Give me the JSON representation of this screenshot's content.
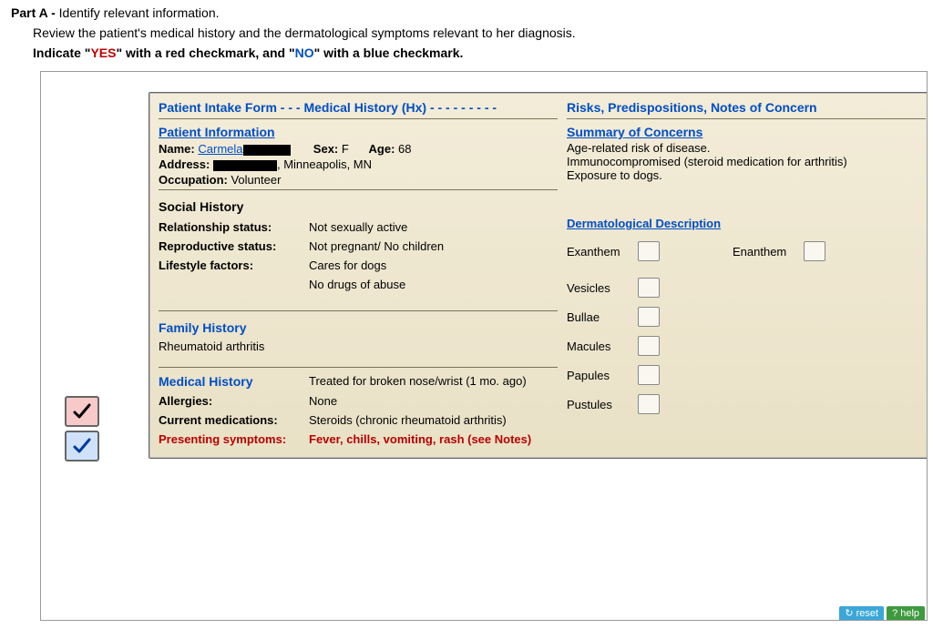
{
  "header": {
    "part_label": "Part A -",
    "part_title": "Identify relevant information.",
    "instruction1": "Review the patient's medical history and the dermatological symptoms relevant to her diagnosis.",
    "instruction2_prefix": "Indicate \"",
    "yes": "YES",
    "instruction2_mid": "\" with a red checkmark, and \"",
    "no": "NO",
    "instruction2_suffix": "\" with a blue checkmark."
  },
  "form": {
    "top_left_title_1": "Patient Intake Form",
    "top_left_dash": " - - - ",
    "top_left_title_2": "Medical History (Hx)",
    "top_left_trail": " - - - - - - - - -",
    "top_right_title": "Risks, Predispositions, Notes of Concern",
    "patient_info": {
      "heading": "Patient Information",
      "name_label": "Name:",
      "name_value": "Carmela",
      "sex_label": "Sex:",
      "sex_value": "F",
      "age_label": "Age:",
      "age_value": "68",
      "address_label": "Address:",
      "address_value": ", Minneapolis, MN",
      "occupation_label": "Occupation:",
      "occupation_value": "Volunteer"
    },
    "social": {
      "heading": "Social History",
      "rel_label": "Relationship status:",
      "rel_value": "Not sexually active",
      "rep_label": "Reproductive status:",
      "rep_value": "Not pregnant/ No children",
      "life_label": "Lifestyle factors:",
      "life_value1": "Cares for dogs",
      "life_value2": "No drugs of abuse"
    },
    "family": {
      "heading": "Family History",
      "value": "Rheumatoid arthritis"
    },
    "medical": {
      "heading": "Medical History",
      "heading_value": "Treated for broken nose/wrist (1 mo. ago)",
      "allergies_label": "Allergies:",
      "allergies_value": "None",
      "meds_label": "Current medications:",
      "meds_value": "Steroids (chronic rheumatoid arthritis)",
      "presenting_label": "Presenting symptoms:",
      "presenting_value": "Fever, chills, vomiting, rash (see Notes)"
    },
    "concerns": {
      "heading": "Summary of Concerns",
      "l1": "Age-related risk of disease.",
      "l2": "Immunocompromised (steroid medication for arthritis)",
      "l3": "Exposure to dogs."
    },
    "derm": {
      "heading": "Dermatological Description",
      "exanthem": "Exanthem",
      "enanthem": "Enanthem",
      "vesicles": "Vesicles",
      "bullae": "Bullae",
      "macules": "Macules",
      "papules": "Papules",
      "pustules": "Pustules"
    }
  },
  "buttons": {
    "reset": "reset",
    "help": "help"
  },
  "palette": {
    "yes_icon": "check-icon",
    "no_icon": "check-icon"
  }
}
